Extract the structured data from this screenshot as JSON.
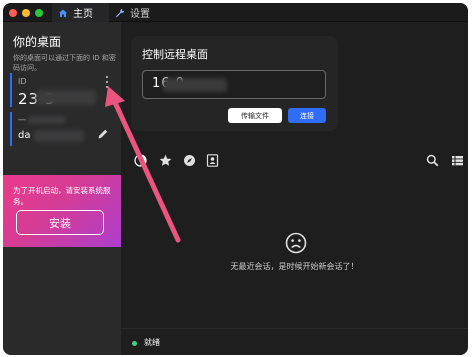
{
  "window": {
    "tabs": [
      {
        "label": "主页",
        "icon": "home-icon",
        "active": true
      },
      {
        "label": "设置",
        "icon": "wrench-icon",
        "active": false
      }
    ]
  },
  "sidebar": {
    "title": "你的桌面",
    "description": "你的桌面可以通过下面的 ID 和密码访问。",
    "id_label": "ID",
    "id_value": "23        5",
    "password_label": "一",
    "password_value": "da",
    "install": {
      "text": "为了开机启动，请安装系统服务。",
      "button_label": "安装"
    }
  },
  "remote": {
    "title": "控制远程桌面",
    "input_value": "16          0",
    "transfer_label": "传输文件",
    "connect_label": "连接"
  },
  "toolbar": {
    "icons": [
      "recent-sessions-icon",
      "favorites-star-icon",
      "discovered-compass-icon",
      "address-book-icon",
      "search-icon",
      "view-list-icon"
    ]
  },
  "sessions": {
    "empty_text": "无最近会话，是时候开始新会话了！"
  },
  "status": {
    "text": "就绪",
    "color": "#3fcf8e"
  },
  "colors": {
    "accent": "#2f6df6",
    "install_gradient_start": "#ea3a8c",
    "install_gradient_end": "#ad3ecd",
    "annotation_arrow": "#e9557f"
  }
}
